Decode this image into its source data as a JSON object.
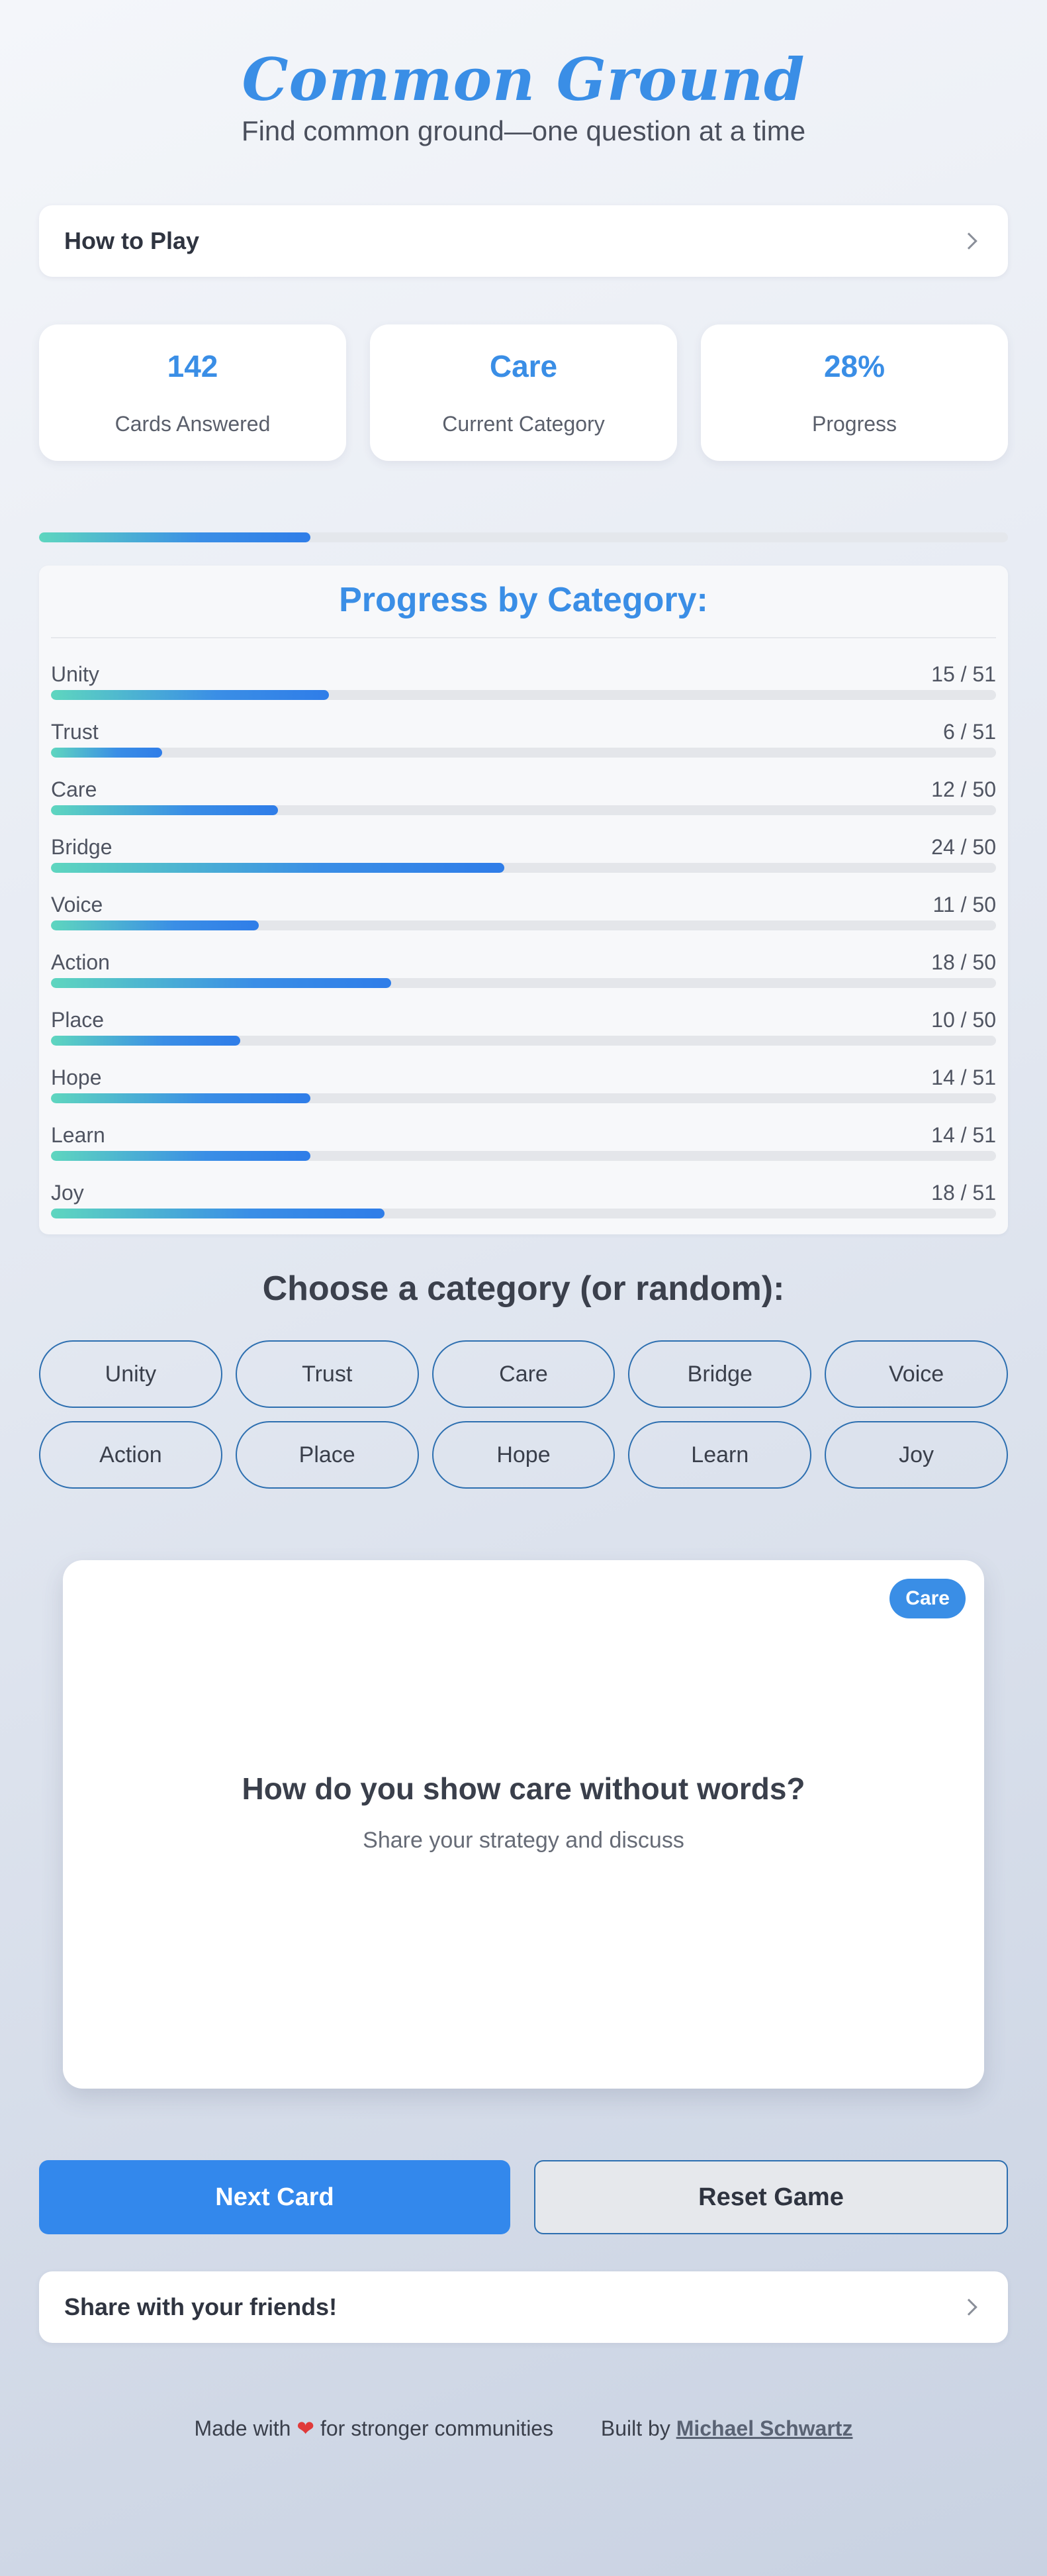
{
  "header": {
    "title": "Common Ground",
    "subtitle": "Find common ground—one question at a time"
  },
  "how_to_play": {
    "label": "How to Play",
    "icon": "chevron-right-icon"
  },
  "stats": [
    {
      "value": "142",
      "caption": "Cards Answered"
    },
    {
      "value": "Care",
      "caption": "Current Category"
    },
    {
      "value": "28%",
      "caption": "Progress"
    }
  ],
  "overall_progress": 0.28,
  "category_progress": {
    "title": "Progress by Category:",
    "items": [
      {
        "name": "Unity",
        "count": "15 / 51",
        "done": 15,
        "total": 51
      },
      {
        "name": "Trust",
        "count": "6 / 51",
        "done": 6,
        "total": 51
      },
      {
        "name": "Care",
        "count": "12 / 50",
        "done": 12,
        "total": 50
      },
      {
        "name": "Bridge",
        "count": "24 / 50",
        "done": 24,
        "total": 50
      },
      {
        "name": "Voice",
        "count": "11 / 50",
        "done": 11,
        "total": 50
      },
      {
        "name": "Action",
        "count": "18 / 50",
        "done": 18,
        "total": 50
      },
      {
        "name": "Place",
        "count": "10 / 50",
        "done": 10,
        "total": 50
      },
      {
        "name": "Hope",
        "count": "14 / 51",
        "done": 14,
        "total": 51
      },
      {
        "name": "Learn",
        "count": "14 / 51",
        "done": 14,
        "total": 51
      },
      {
        "name": "Joy",
        "count": "18 / 51",
        "done": 18,
        "total": 51
      }
    ]
  },
  "chooser": {
    "title": "Choose a category (or random):",
    "options": [
      "Unity",
      "Trust",
      "Care",
      "Bridge",
      "Voice",
      "Action",
      "Place",
      "Hope",
      "Learn",
      "Joy"
    ]
  },
  "card": {
    "badge": "Care",
    "question": "How do you show care without words?",
    "prompt": "Share your strategy and discuss"
  },
  "actions": {
    "next_label": "Next Card",
    "reset_label": "Reset Game"
  },
  "share": {
    "label": "Share with your friends!",
    "icon": "chevron-right-icon"
  },
  "footer": {
    "made_with_prefix": "Made with",
    "heart": "❤",
    "made_with_suffix": "for stronger communities",
    "built_by": "Built by",
    "author": "Michael Schwartz"
  },
  "colors": {
    "accent": "#3a8ee6",
    "gradient_start": "#5ed6bf",
    "gradient_end": "#2f7de8",
    "outline": "#2d6fb0",
    "heart": "#e03a3a"
  }
}
